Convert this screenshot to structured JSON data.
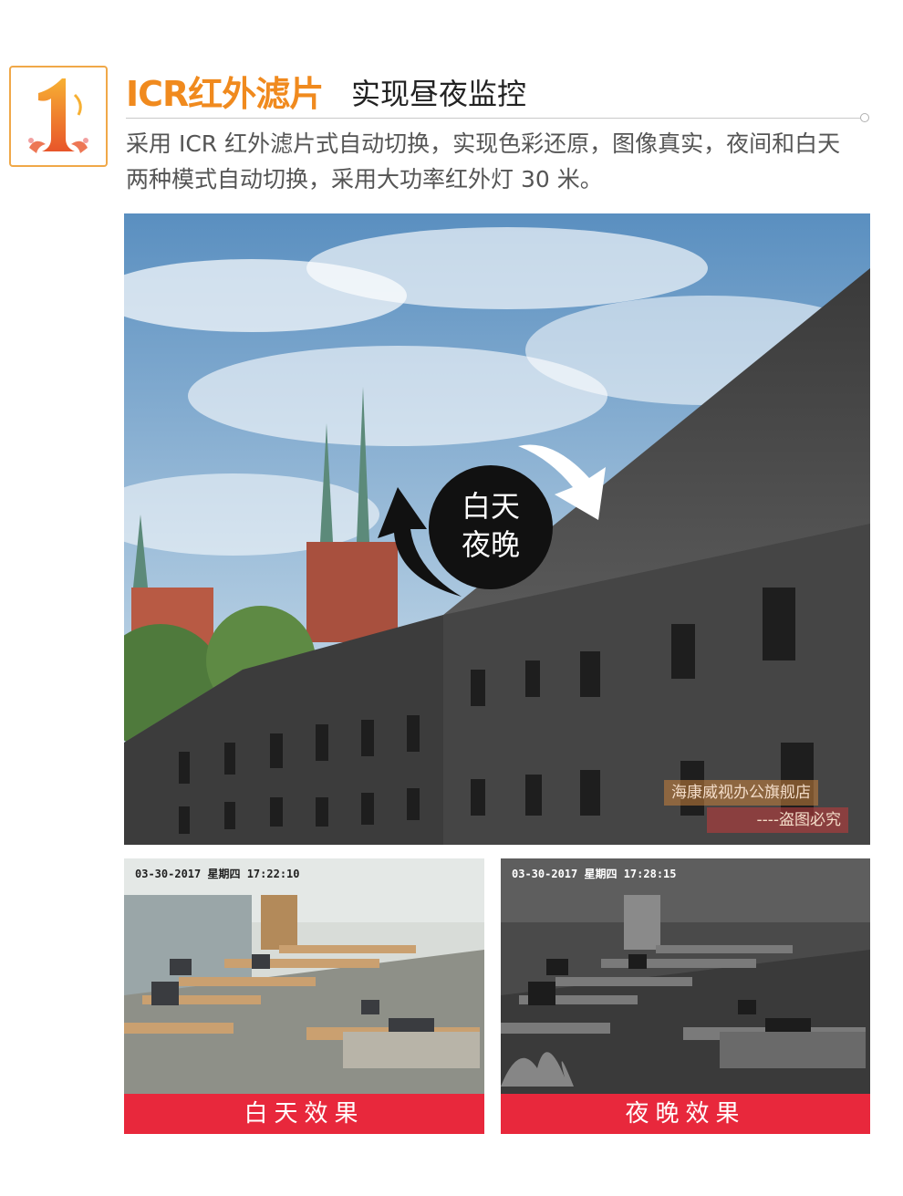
{
  "header": {
    "badge_number": "1",
    "title_main": "ICR红外滤片",
    "title_sub": "实现昼夜监控",
    "description": "采用 ICR 红外滤片式自动切换，实现色彩还原，图像真实，夜间和白天两种模式自动切换，采用大功率红外灯 30 米。"
  },
  "hero": {
    "switch_day": "白天",
    "switch_night": "夜晚",
    "watermark_shop": "海康威视办公旗舰店",
    "watermark_warning": "----盗图必究"
  },
  "samples": {
    "day": {
      "timestamp": "03-30-2017 星期四 17:22:10",
      "caption": "白天效果"
    },
    "night": {
      "timestamp": "03-30-2017 星期四 17:28:15",
      "caption": "夜晚效果"
    }
  },
  "colors": {
    "accent_orange": "#f08a1e",
    "caption_red": "#e8283c",
    "badge_border": "#f0a848"
  }
}
